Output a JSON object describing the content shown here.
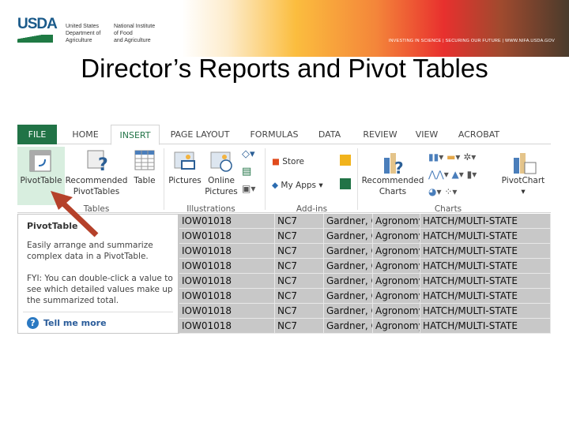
{
  "banner": {
    "logo_text": "USDA",
    "org1": [
      "United States",
      "Department of",
      "Agriculture"
    ],
    "org2": [
      "National Institute",
      "of Food",
      "and Agriculture"
    ],
    "tagline": "INVESTING IN SCIENCE | SECURING OUR FUTURE | WWW.NIFA.USDA.GOV"
  },
  "slide_title": "Director’s Reports and Pivot Tables",
  "tabs": [
    "FILE",
    "HOME",
    "INSERT",
    "PAGE LAYOUT",
    "FORMULAS",
    "DATA",
    "REVIEW",
    "VIEW",
    "ACROBAT"
  ],
  "active_tab": "INSERT",
  "ribbon": {
    "pivottable": "PivotTable",
    "recommended_pivottables": [
      "Recommended",
      "PivotTables"
    ],
    "table": "Table",
    "tables_group": "Tables",
    "pictures": "Pictures",
    "online_pictures": [
      "Online",
      "Pictures"
    ],
    "illustrations_group": "Illustrations",
    "store": "Store",
    "my_apps": "My Apps",
    "addins_group": "Add-ins",
    "recommended_charts": [
      "Recommended",
      "Charts"
    ],
    "charts_group": "Charts",
    "pivotchart": "PivotChart"
  },
  "tooltip": {
    "title": "PivotTable",
    "desc": "Easily arrange and summarize complex data in a PivotTable.",
    "fyi": "FYI: You can double-click a value to see which detailed values make up the summarized total.",
    "link": "Tell me more"
  },
  "rows": [
    [
      "IOW01018",
      "NC7",
      "Gardner, C",
      "Agronomy",
      "HATCH/MULTI-STATE"
    ],
    [
      "IOW01018",
      "NC7",
      "Gardner, C",
      "Agronomy",
      "HATCH/MULTI-STATE"
    ],
    [
      "IOW01018",
      "NC7",
      "Gardner, C",
      "Agronomy",
      "HATCH/MULTI-STATE"
    ],
    [
      "IOW01018",
      "NC7",
      "Gardner, C",
      "Agronomy",
      "HATCH/MULTI-STATE"
    ],
    [
      "IOW01018",
      "NC7",
      "Gardner, C",
      "Agronomy",
      "HATCH/MULTI-STATE"
    ],
    [
      "IOW01018",
      "NC7",
      "Gardner, C",
      "Agronomy",
      "HATCH/MULTI-STATE"
    ],
    [
      "IOW01018",
      "NC7",
      "Gardner, C",
      "Agronomy",
      "HATCH/MULTI-STATE"
    ],
    [
      "IOW01018",
      "NC7",
      "Gardner, C",
      "Agronomy",
      "HATCH/MULTI-STATE"
    ]
  ],
  "colors": {
    "excel_green": "#217346",
    "arrow": "#b5412a",
    "grid_bg": "#c8c8c8"
  }
}
